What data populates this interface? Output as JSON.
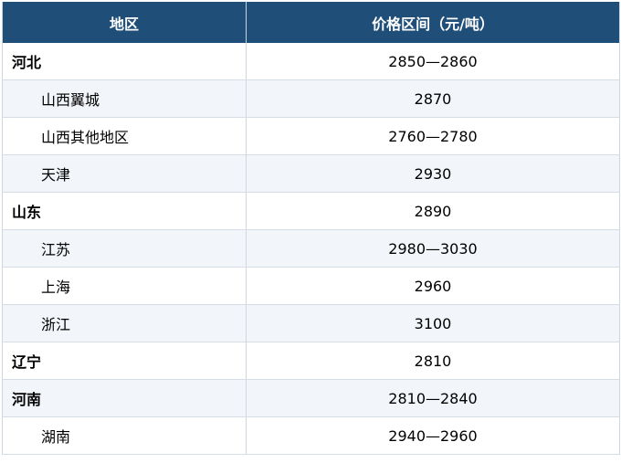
{
  "table": {
    "headers": [
      "地区",
      "价格区间（元/吨）"
    ],
    "rows": [
      {
        "region": "河北",
        "price": "2850—2860",
        "level": "main"
      },
      {
        "region": "山西翼城",
        "price": "2870",
        "level": "sub"
      },
      {
        "region": "山西其他地区",
        "price": "2760—2780",
        "level": "sub"
      },
      {
        "region": "天津",
        "price": "2930",
        "level": "sub"
      },
      {
        "region": "山东",
        "price": "2890",
        "level": "main"
      },
      {
        "region": "江苏",
        "price": "2980—3030",
        "level": "sub"
      },
      {
        "region": "上海",
        "price": "2960",
        "level": "sub"
      },
      {
        "region": "浙江",
        "price": "3100",
        "level": "sub"
      },
      {
        "region": "辽宁",
        "price": "2810",
        "level": "main"
      },
      {
        "region": "河南",
        "price": "2810—2840",
        "level": "main"
      },
      {
        "region": "湖南",
        "price": "2940—2960",
        "level": "sub"
      }
    ]
  },
  "colors": {
    "header_bg": "#1f4e79",
    "header_text": "#ffffff",
    "stripe": "#f2f6fa"
  }
}
